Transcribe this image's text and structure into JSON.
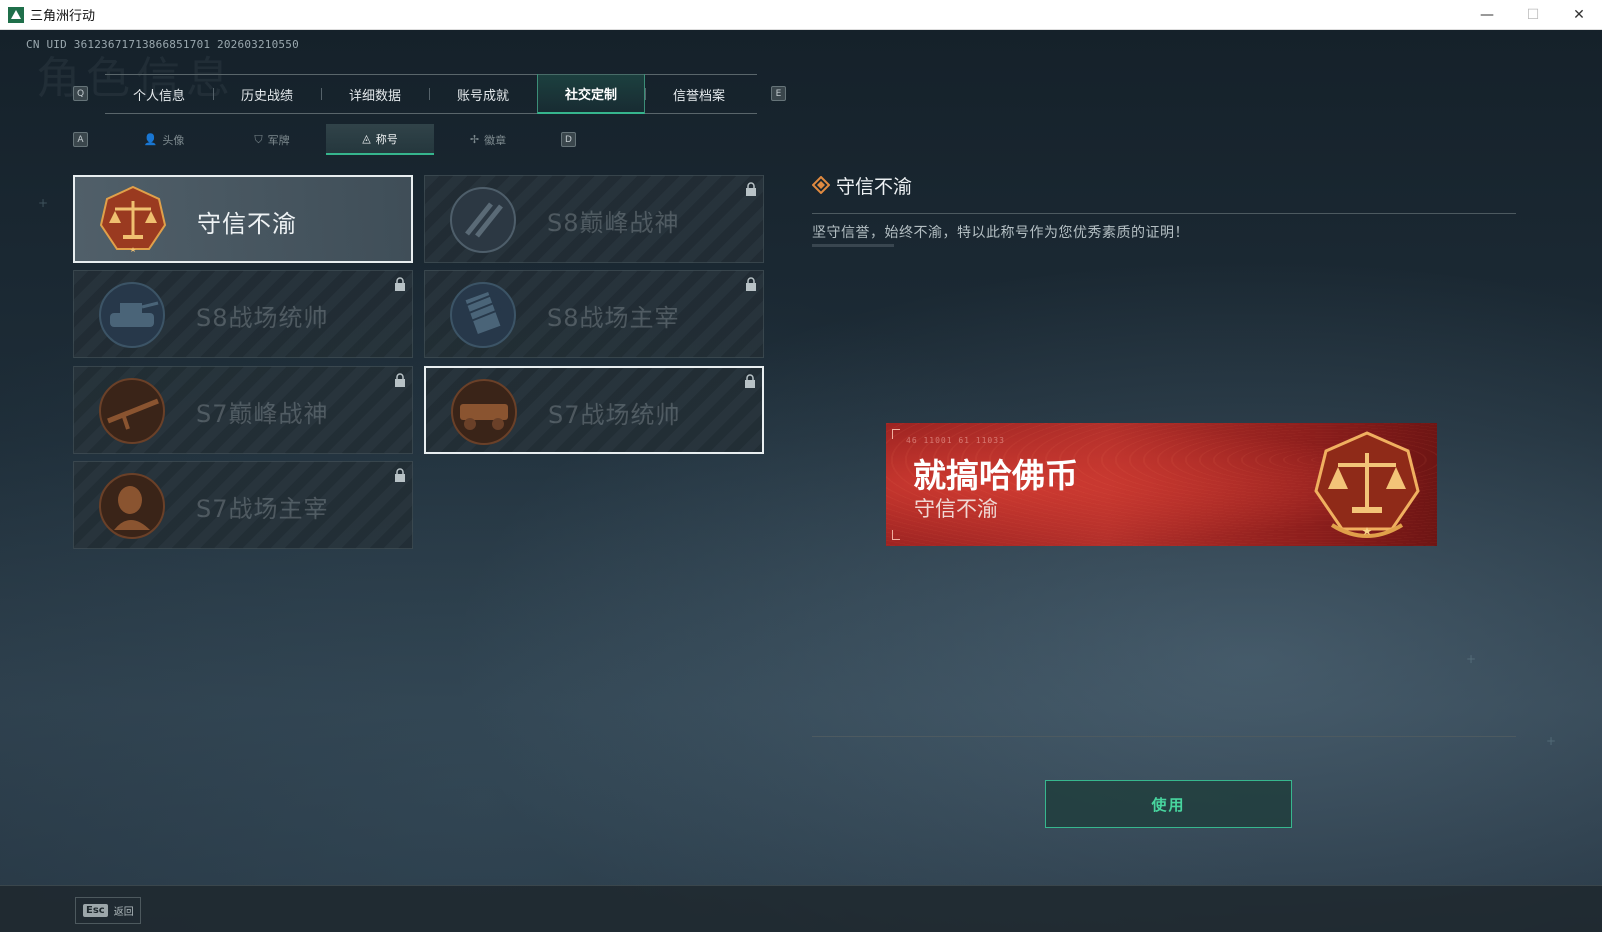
{
  "window": {
    "title": "三角洲行动",
    "minimize": "—",
    "maximize": "☐",
    "close": "✕"
  },
  "uid": "CN UID 3612367171386685170​1 202603210550",
  "background_heading": "角色信息",
  "tab_keys": {
    "prev": "Q",
    "next": "E"
  },
  "tabs": [
    {
      "label": "个人信息",
      "active": false
    },
    {
      "label": "历史战绩",
      "active": false
    },
    {
      "label": "详细数据",
      "active": false
    },
    {
      "label": "账号成就",
      "active": false
    },
    {
      "label": "社交定制",
      "active": true
    },
    {
      "label": "信誉档案",
      "active": false
    }
  ],
  "subtab_keys": {
    "prev": "A",
    "next": "D"
  },
  "subtabs": [
    {
      "label": "头像",
      "icon": "person-icon",
      "glyph": "👤",
      "active": false
    },
    {
      "label": "军牌",
      "icon": "dogtag-icon",
      "glyph": "⛉",
      "active": false
    },
    {
      "label": "称号",
      "icon": "title-icon",
      "glyph": "◬",
      "active": true
    },
    {
      "label": "徽章",
      "icon": "badge-icon",
      "glyph": "✢",
      "active": false
    }
  ],
  "titles": [
    {
      "name": "守信不渝",
      "locked": false,
      "selected": true,
      "emblem": "scales-emblem",
      "colors": [
        "#e07a3a",
        "#8a2a18"
      ]
    },
    {
      "name": "S8巅峰战神",
      "locked": true,
      "selected": false,
      "emblem": "slash-emblem",
      "colors": [
        "#4a5a68",
        "#2a3440"
      ]
    },
    {
      "name": "S8战场统帅",
      "locked": true,
      "selected": false,
      "emblem": "tank-emblem",
      "colors": [
        "#3d5565",
        "#22303a"
      ]
    },
    {
      "name": "S8战场主宰",
      "locked": true,
      "selected": false,
      "emblem": "building-emblem",
      "colors": [
        "#3d5060",
        "#22303a"
      ]
    },
    {
      "name": "S7巅峰战神",
      "locked": true,
      "selected": false,
      "emblem": "rifle-emblem",
      "colors": [
        "#6a4028",
        "#2e1e18"
      ]
    },
    {
      "name": "S7战场统帅",
      "locked": true,
      "selected": false,
      "outlined": true,
      "emblem": "vehicle-emblem",
      "colors": [
        "#6a4028",
        "#2e1e18"
      ]
    },
    {
      "name": "S7战场主宰",
      "locked": true,
      "selected": false,
      "emblem": "soldier-emblem",
      "colors": [
        "#6a4028",
        "#2e1e18"
      ]
    }
  ],
  "detail": {
    "title": "守信不渝",
    "description": "坚守信誉，始终不渝，特以此称号作为您优秀素质的证明！"
  },
  "banner": {
    "code": "46 11001 61 11033",
    "player_name": "就搞哈佛币",
    "title": "守信不渝"
  },
  "use_button": "使用",
  "footer": {
    "esc_key": "Esc",
    "esc_label": "返回"
  },
  "colors": {
    "accent": "#36b58d",
    "use_text": "#48d59f",
    "banner_red": "#b3302b",
    "emblem_gold": "#e0a04a"
  }
}
